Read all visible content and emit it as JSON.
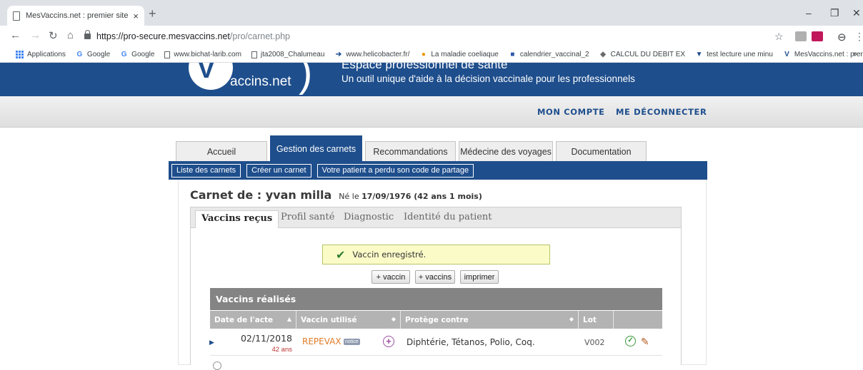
{
  "browser": {
    "tab_title": "MesVaccins.net : premier site de",
    "tab_close": "×",
    "new_tab": "+",
    "url_host": "https://pro-secure.mesvaccins.net",
    "url_path": "/pro/carnet.php",
    "window_controls": {
      "minimize": "–",
      "maximize": "❐",
      "close": "✕"
    },
    "bookmarks": [
      {
        "label": "Applications",
        "icon": "apps-icon"
      },
      {
        "label": "Google",
        "icon": "google-icon"
      },
      {
        "label": "Google",
        "icon": "google-icon"
      },
      {
        "label": "www.bichat-larib.com",
        "icon": "page-icon"
      },
      {
        "label": "jta2008_Chalumeau",
        "icon": "page-icon"
      },
      {
        "label": "www.helicobacter.fr/",
        "icon": "arrow-icon"
      },
      {
        "label": "La maladie coeliaque",
        "icon": "circle-icon"
      },
      {
        "label": "calendrier_vaccinal_2",
        "icon": "flag-icon"
      },
      {
        "label": "CALCUL DU DEBIT EX",
        "icon": "drop-icon"
      },
      {
        "label": "test lecture une minu",
        "icon": "heart-icon"
      },
      {
        "label": "MesVaccins.net : prer",
        "icon": "v-icon"
      }
    ],
    "bookmarks_more": "»"
  },
  "site": {
    "logo_text": "accins.net",
    "logo_letter": "V",
    "header_title": "Espace professionnel de santé",
    "header_subtitle": "Un outil unique d'aide à la décision vaccinale pour les professionnels",
    "account_links": [
      "MON COMPTE",
      "ME DÉCONNECTER"
    ]
  },
  "main_tabs": [
    {
      "label": "Accueil",
      "active": false
    },
    {
      "label": "Gestion des carnets",
      "active": true
    },
    {
      "label": "Recommandations",
      "active": false
    },
    {
      "label": "Médecine des voyages",
      "active": false
    },
    {
      "label": "Documentation",
      "active": false
    }
  ],
  "subnav": [
    "Liste des carnets",
    "Créer un carnet",
    "Votre patient a perdu son code de partage"
  ],
  "patient": {
    "prefix": "Carnet de : yvan milla",
    "born_label": "Né le",
    "born_value": "17/09/1976 (42 ans 1 mois)"
  },
  "sub_tabs": [
    {
      "label": "Vaccins reçus",
      "active": true
    },
    {
      "label": "Profil santé",
      "active": false
    },
    {
      "label": "Diagnostic",
      "active": false
    },
    {
      "label": "Identité du patient",
      "active": false
    }
  ],
  "message": "Vaccin enregistré.",
  "action_buttons": [
    "+ vaccin",
    "+ vaccins",
    "imprimer"
  ],
  "table": {
    "title": "Vaccins réalisés",
    "columns": [
      "Date de l'acte",
      "Vaccin utilisé",
      "Protège contre",
      "Lot",
      ""
    ],
    "rows": [
      {
        "date": "02/11/2018",
        "age": "42 ans",
        "vaccine": "REPEVAX",
        "notice": "notice",
        "protects": "Diphtérie, Tétanos, Polio, Coq.",
        "lot": "V002"
      }
    ]
  }
}
